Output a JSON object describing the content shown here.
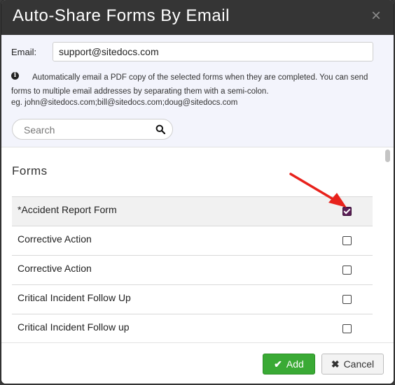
{
  "dialog": {
    "title": "Auto-Share Forms By Email",
    "close_icon": "×"
  },
  "email": {
    "label": "Email:",
    "value": "support@sitedocs.com"
  },
  "info": {
    "icon": "i",
    "text": "Automatically email a PDF copy of the selected forms when they are completed. You can send forms to multiple email addresses by separating them with a semi-colon.",
    "example": "eg. john@sitedocs.com;bill@sitedocs.com;doug@sitedocs.com"
  },
  "search": {
    "placeholder": "Search"
  },
  "forms": {
    "heading": "Forms",
    "items": [
      {
        "name": "*Accident Report Form",
        "checked": true
      },
      {
        "name": "Corrective Action",
        "checked": false
      },
      {
        "name": "Corrective Action",
        "checked": false
      },
      {
        "name": "Critical Incident Follow Up",
        "checked": false
      },
      {
        "name": "Critical Incident Follow up",
        "checked": false
      }
    ]
  },
  "footer": {
    "add_label": "Add",
    "add_icon": "✔",
    "cancel_label": "Cancel",
    "cancel_icon": "✖"
  },
  "colors": {
    "titlebar": "#353535",
    "add_button": "#3aaa35",
    "checkbox_checked": "#5a1e55",
    "arrow": "#e8221c"
  }
}
